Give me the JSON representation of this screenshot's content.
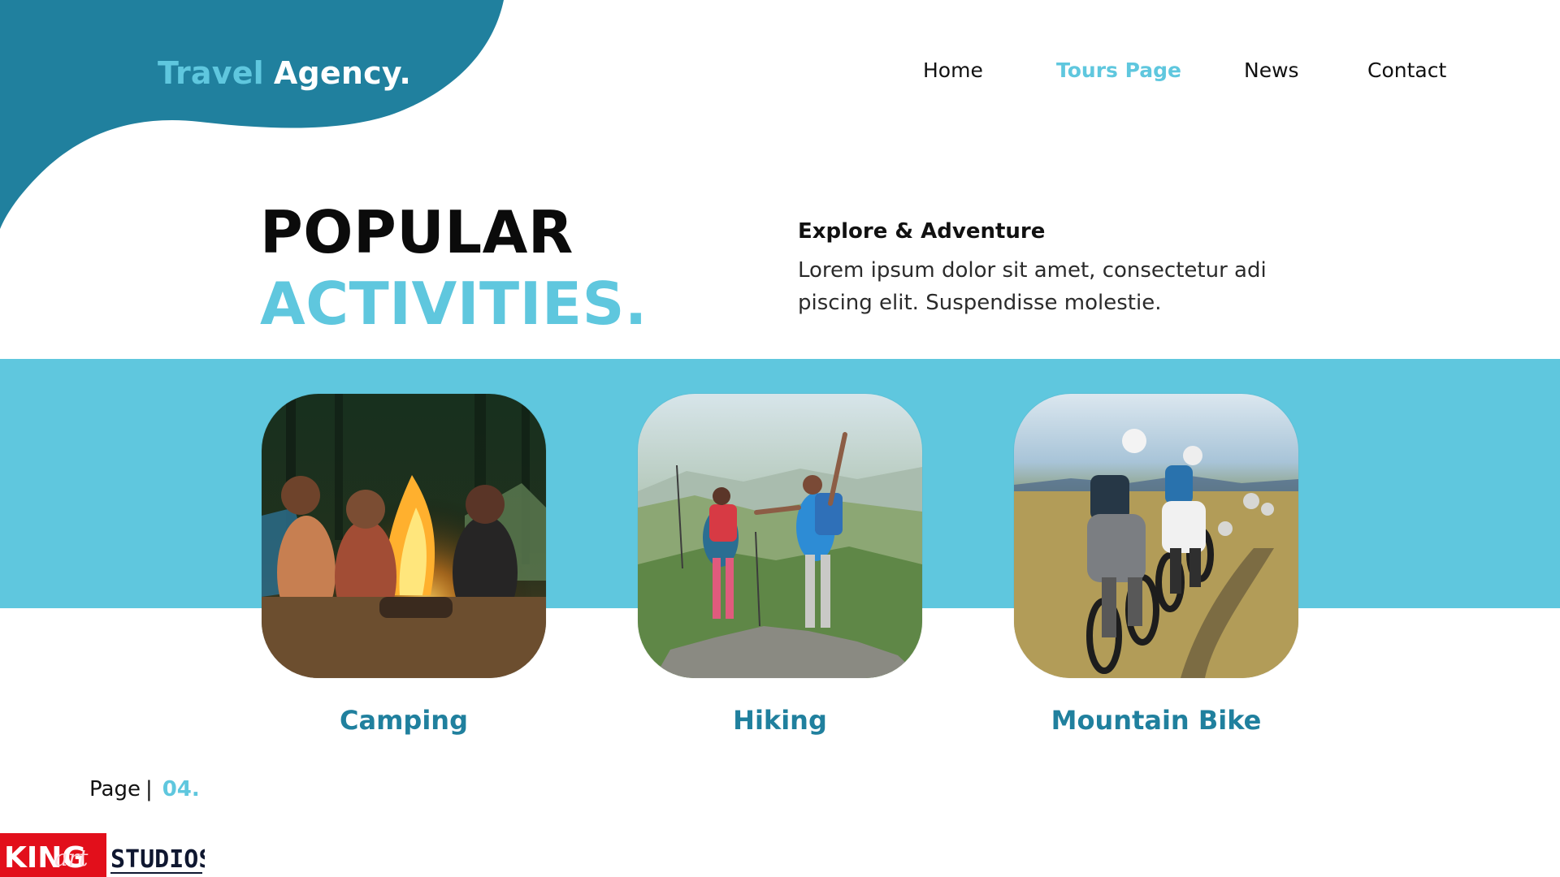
{
  "brand": {
    "part1": "Travel",
    "part2": "Agency."
  },
  "nav": {
    "items": [
      {
        "label": "Home",
        "active": false
      },
      {
        "label": "Tours Page",
        "active": true
      },
      {
        "label": "News",
        "active": false
      },
      {
        "label": "Contact",
        "active": false
      }
    ]
  },
  "hero": {
    "title_line1": "POPULAR",
    "title_line2": "ACTIVITIES."
  },
  "explore": {
    "title": "Explore & Adventure",
    "body": "Lorem ipsum dolor sit amet, consectetur adi piscing elit. Suspendisse molestie."
  },
  "activities": [
    {
      "label": "Camping",
      "image": "campfire-photo"
    },
    {
      "label": "Hiking",
      "image": "hikers-mountain-photo"
    },
    {
      "label": "Mountain Bike",
      "image": "mountain-bikers-photo"
    }
  ],
  "page": {
    "label": "Page",
    "separator": "|",
    "number": "04."
  },
  "watermark": {
    "text_king": "KING",
    "text_art": "art",
    "text_studios": "STUDIOS"
  },
  "colors": {
    "primary": "#20809E",
    "accent": "#5FC7DE",
    "band": "#5FC7DE",
    "text": "#111111"
  }
}
